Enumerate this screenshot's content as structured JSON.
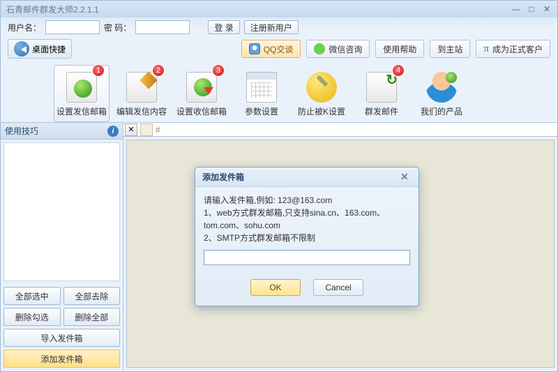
{
  "window": {
    "title": "石青邮件群发大师2.2.1.1"
  },
  "login": {
    "user_label": "用户名：",
    "pass_label": "密  码：",
    "login_btn": "登 录",
    "register_btn": "注册新用户"
  },
  "toolbar": {
    "desktop_quick": "桌面快捷",
    "qq_chat": "QQ交谈",
    "wechat_consult": "微信咨询",
    "help": "使用帮助",
    "home": "到主站",
    "upgrade": "成为正式客户"
  },
  "ribbon": [
    {
      "label": "设置发信邮箱",
      "badge": "1"
    },
    {
      "label": "编辑发信内容",
      "badge": "2"
    },
    {
      "label": "设置收信邮箱",
      "badge": "3"
    },
    {
      "label": "参数设置",
      "badge": ""
    },
    {
      "label": "防止被K设置",
      "badge": ""
    },
    {
      "label": "群发邮件",
      "badge": "4"
    },
    {
      "label": "我们的产品",
      "badge": ""
    }
  ],
  "left": {
    "header": "使用技巧",
    "btn_select_all": "全部选中",
    "btn_remove_all": "全部去除",
    "btn_del_checked": "删除勾选",
    "btn_del_all": "删除全部",
    "btn_import": "导入发件箱",
    "btn_add": "添加发件箱"
  },
  "tabs": {
    "close_glyph": "✕",
    "hash": "#"
  },
  "dialog": {
    "title": "添加发件箱",
    "line1": "请输入发件箱,例如: 123@163.com",
    "line2": "1、web方式群发邮箱,只支持sina.cn、163.com、tom.com、sohu.com",
    "line3": "2、SMTP方式群发邮箱不限制",
    "ok": "OK",
    "cancel": "Cancel"
  }
}
